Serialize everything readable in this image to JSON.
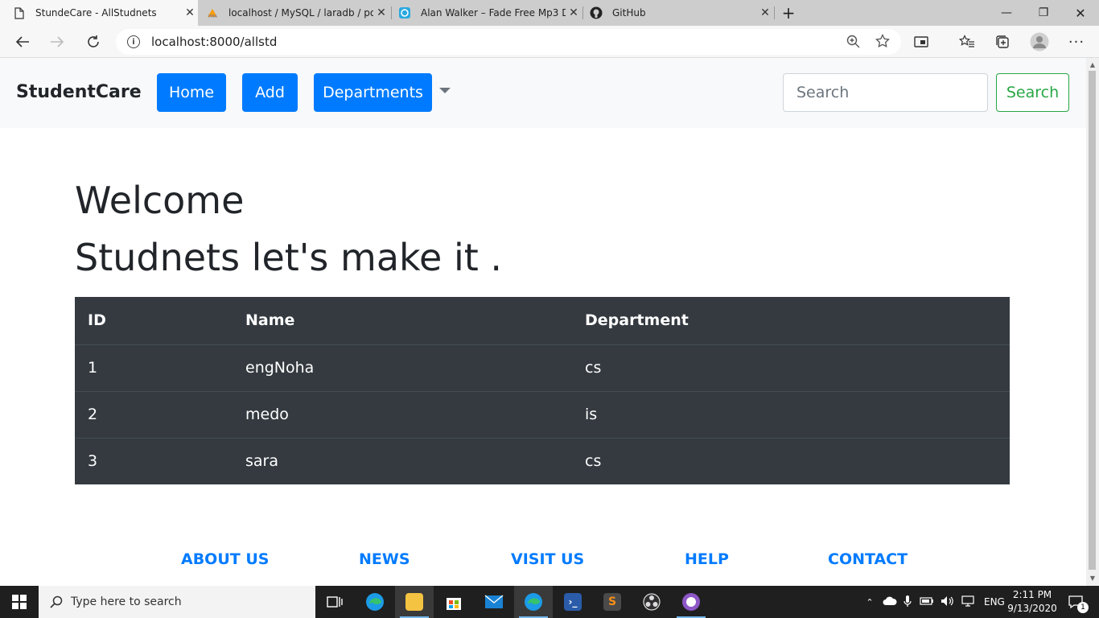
{
  "browser": {
    "tabs": [
      {
        "title": "StundeCare - AllStudnets",
        "icon": "page-icon",
        "active": true
      },
      {
        "title": "localhost / MySQL / laradb / pos",
        "icon": "phpmyadmin-icon",
        "active": false
      },
      {
        "title": "Alan Walker – Fade Free Mp3 Do",
        "icon": "site-icon",
        "active": false
      },
      {
        "title": "GitHub",
        "icon": "github-icon",
        "active": false
      }
    ],
    "url": "localhost:8000/allstd"
  },
  "navbar": {
    "brand": "StudentCare",
    "home_label": "Home",
    "add_label": "Add",
    "departments_label": "Departments",
    "search_placeholder": "Search",
    "search_button": "Search"
  },
  "main": {
    "heading_line1": "Welcome",
    "heading_line2": "Studnets let's make it ."
  },
  "table": {
    "headers": [
      "ID",
      "Name",
      "Department"
    ],
    "rows": [
      [
        "1",
        "engNoha",
        "cs"
      ],
      [
        "2",
        "medo",
        "is"
      ],
      [
        "3",
        "sara",
        "cs"
      ]
    ]
  },
  "footer": {
    "links": [
      "ABOUT US",
      "NEWS",
      "VISIT US",
      "HELP",
      "CONTACT"
    ]
  },
  "taskbar": {
    "search_placeholder": "Type here to search",
    "language": "ENG",
    "time": "2:11 PM",
    "date": "9/13/2020",
    "notification_count": "1"
  },
  "colors": {
    "primary": "#007bff",
    "success": "#28a745",
    "table_dark": "#343a40"
  }
}
